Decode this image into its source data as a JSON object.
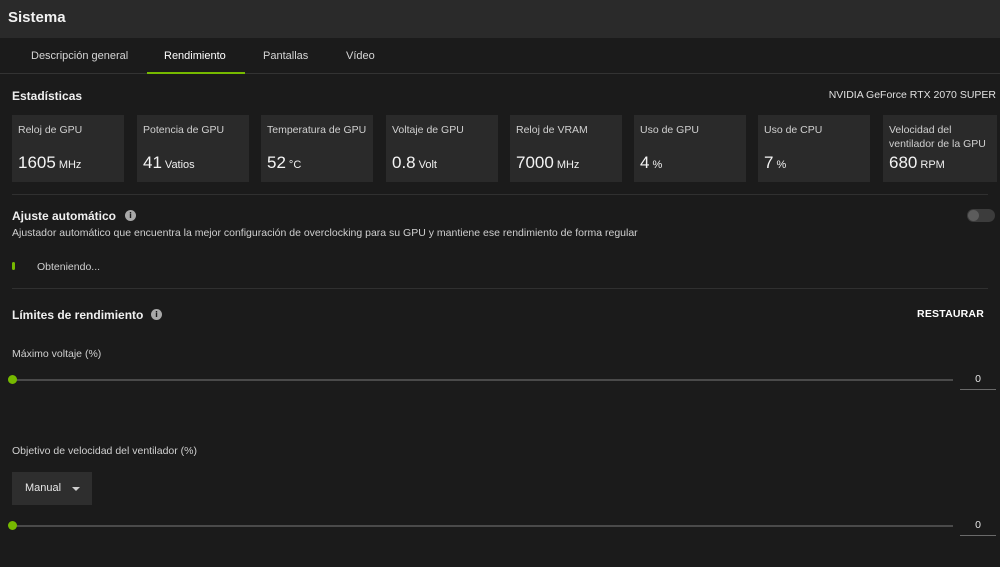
{
  "window": {
    "title": "Sistema"
  },
  "tabs": [
    {
      "label": "Descripción general",
      "active": false
    },
    {
      "label": "Rendimiento",
      "active": true
    },
    {
      "label": "Pantallas",
      "active": false
    },
    {
      "label": "Vídeo",
      "active": false
    }
  ],
  "stats": {
    "heading": "Estadísticas",
    "gpu_name": "NVIDIA GeForce RTX 2070 SUPER",
    "items": [
      {
        "label": "Reloj de GPU",
        "value": "1605",
        "unit": "MHz"
      },
      {
        "label": "Potencia de GPU",
        "value": "41",
        "unit": "Vatios"
      },
      {
        "label": "Temperatura de GPU",
        "value": "52",
        "unit": "°C"
      },
      {
        "label": "Voltaje de GPU",
        "value": "0.8",
        "unit": "Volt"
      },
      {
        "label": "Reloj de VRAM",
        "value": "7000",
        "unit": "MHz"
      },
      {
        "label": "Uso de GPU",
        "value": "4",
        "unit": "%"
      },
      {
        "label": "Uso de CPU",
        "value": "7",
        "unit": "%"
      },
      {
        "label": "Velocidad del ventilador de la GPU",
        "value": "680",
        "unit": "RPM"
      }
    ]
  },
  "auto_tune": {
    "heading": "Ajuste automático",
    "info_icon": "info-icon",
    "description": "Ajustador automático que encuentra la mejor configuración de overclocking para su GPU y mantiene ese rendimiento de forma regular",
    "enabled": false,
    "status": "Obteniendo..."
  },
  "limits": {
    "heading": "Límites de rendimiento",
    "info_icon": "info-icon",
    "restore_label": "RESTAURAR",
    "max_voltage": {
      "label": "Máximo voltaje (%)",
      "value": "0",
      "fraction": 0
    },
    "fan_target": {
      "label": "Objetivo de velocidad del ventilador (%)",
      "mode": "Manual",
      "value": "0",
      "fraction": 0
    }
  },
  "colors": {
    "accent": "#76b900",
    "background": "#1b1b1b",
    "card": "#2a2a2a"
  }
}
